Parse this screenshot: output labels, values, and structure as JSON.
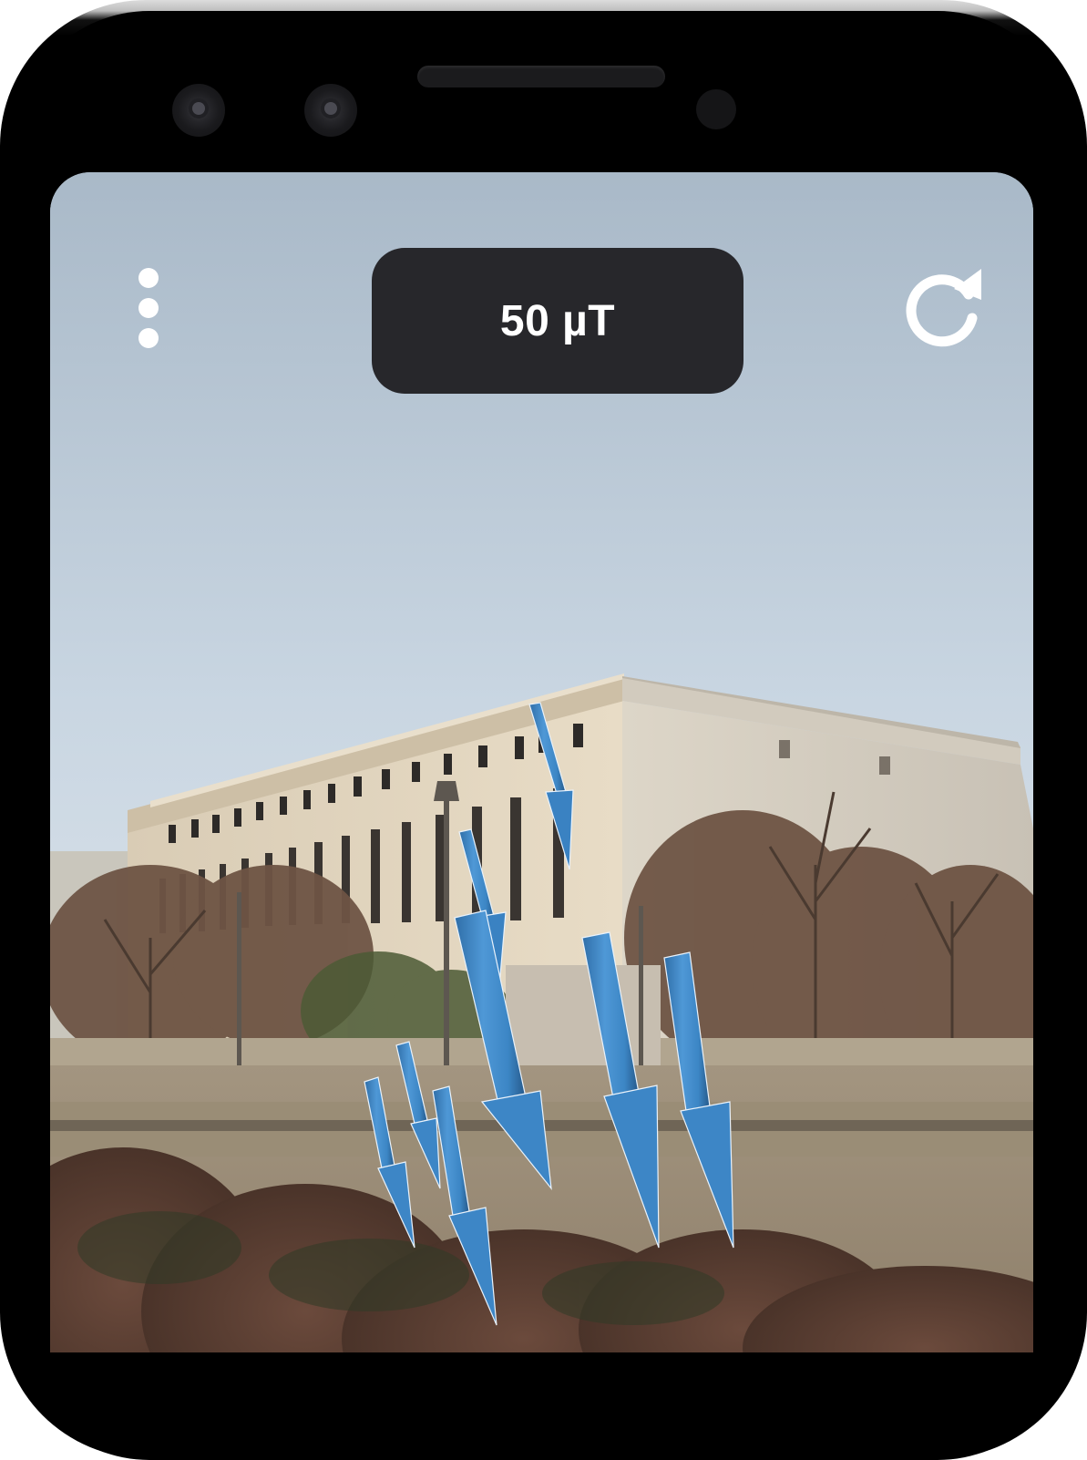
{
  "toolbar": {
    "menu_icon": "more-vertical-icon",
    "refresh_icon": "refresh-icon"
  },
  "reading": {
    "value": "50 µT"
  },
  "colors": {
    "badge_background": "#27272b",
    "arrow_blue": "#3d86c6",
    "icon_white": "#ffffff"
  }
}
